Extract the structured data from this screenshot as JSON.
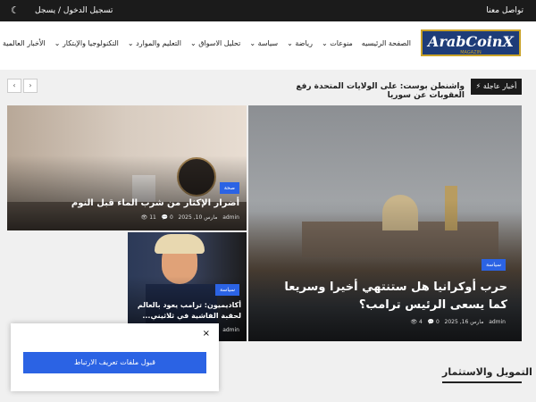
{
  "topbar": {
    "contact": "تواصل معنا",
    "login": "تسجيل الدخول  /  يسجل"
  },
  "logo": {
    "main": "ArabCoinX",
    "sub": "MAGAZIN"
  },
  "nav": {
    "items": [
      "الصفحة الرئيسيه",
      "منوعات",
      "رياضة",
      "سياسة",
      "تحليل الاسواق",
      "التعليم والموارد",
      "التكنولوجيا والإبتكار",
      "الأخبار العالمية عن"
    ]
  },
  "breaking": {
    "label": "أخبار عاجلة",
    "text": "واشنطن بوست: على الولايات المتحدة رفع العقوبات عن سوريا"
  },
  "cards": {
    "health": {
      "category": "صحة",
      "title": "أضرار الإكثار من شرب الماء قبل النوم",
      "author": "admin",
      "date": "مارس 10, 2025",
      "comments": "0",
      "views": "11"
    },
    "main": {
      "category": "سياسة",
      "title": "حرب أوكرانيا هل ستنتهي أخيرا وسريعا كما يسعى الرئيس ترامب؟",
      "author": "admin",
      "date": "مارس 16, 2025",
      "comments": "0",
      "views": "4"
    },
    "trump": {
      "category": "سياسة",
      "title": "أكاديميون: ترامب يعود بالعالم لحقبة الفاشية في ثلاثيني...",
      "author": "admin"
    }
  },
  "section": {
    "title": "التمويل والاستثمار"
  },
  "cookie": {
    "button": "قبول ملفات تعريف الارتباط",
    "close": "×"
  }
}
